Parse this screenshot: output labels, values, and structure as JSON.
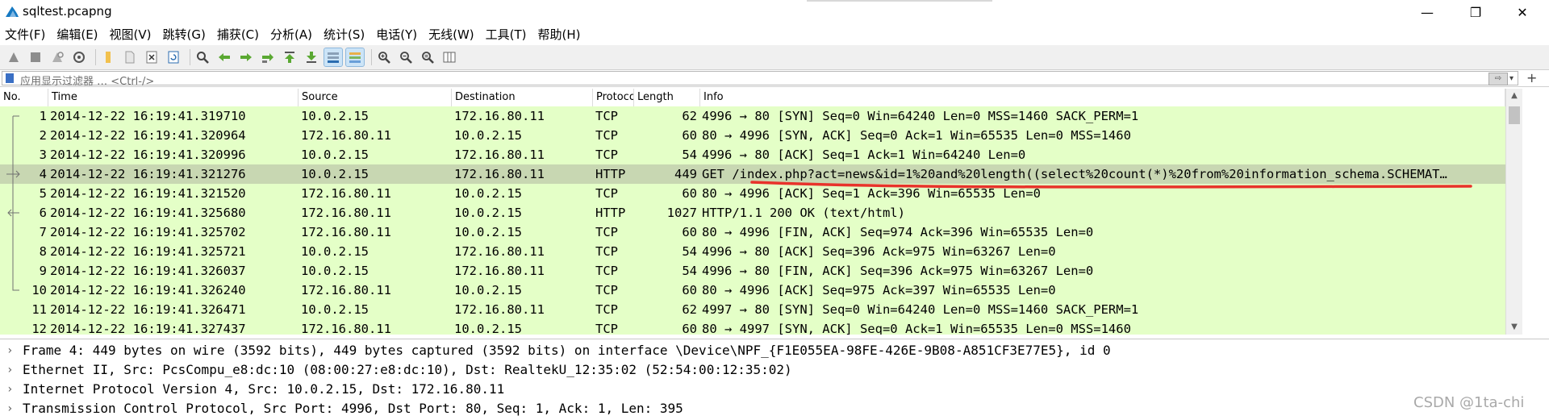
{
  "window": {
    "title": "sqltest.pcapng",
    "minimize": "—",
    "maximize": "❐",
    "close": "✕"
  },
  "menu": [
    "文件(F)",
    "编辑(E)",
    "视图(V)",
    "跳转(G)",
    "捕获(C)",
    "分析(A)",
    "统计(S)",
    "电话(Y)",
    "无线(W)",
    "工具(T)",
    "帮助(H)"
  ],
  "toolbar": {
    "buttons": [
      "start-capture-icon",
      "stop-capture-icon",
      "restart-capture-icon",
      "capture-options-icon",
      "open-file-icon",
      "save-file-icon",
      "close-file-icon",
      "reload-file-icon",
      "find-packet-icon",
      "go-back-icon",
      "go-forward-icon",
      "go-to-packet-icon",
      "go-first-icon",
      "go-last-icon",
      "autoscroll-icon",
      "colorize-icon",
      "zoom-in-icon",
      "zoom-out-icon",
      "zoom-normal-icon",
      "resize-columns-icon"
    ],
    "active": [
      "autoscroll-icon",
      "colorize-icon"
    ]
  },
  "filter": {
    "placeholder": "应用显示过滤器 … <Ctrl-/>",
    "apply": "⇨",
    "dropdown": "▾",
    "add": "+"
  },
  "packet_list": {
    "columns": [
      "No.",
      "Time",
      "Source",
      "Destination",
      "Protocol",
      "Length",
      "Info"
    ],
    "rows": [
      {
        "no": "1",
        "time": "2014-12-22 16:19:41.319710",
        "source": "10.0.2.15",
        "destination": "172.16.80.11",
        "protocol": "TCP",
        "length": "62",
        "info": "4996 → 80 [SYN] Seq=0 Win=64240 Len=0 MSS=1460 SACK_PERM=1"
      },
      {
        "no": "2",
        "time": "2014-12-22 16:19:41.320964",
        "source": "172.16.80.11",
        "destination": "10.0.2.15",
        "protocol": "TCP",
        "length": "60",
        "info": "80 → 4996 [SYN, ACK] Seq=0 Ack=1 Win=65535 Len=0 MSS=1460"
      },
      {
        "no": "3",
        "time": "2014-12-22 16:19:41.320996",
        "source": "10.0.2.15",
        "destination": "172.16.80.11",
        "protocol": "TCP",
        "length": "54",
        "info": "4996 → 80 [ACK] Seq=1 Ack=1 Win=64240 Len=0"
      },
      {
        "no": "4",
        "time": "2014-12-22 16:19:41.321276",
        "source": "10.0.2.15",
        "destination": "172.16.80.11",
        "protocol": "HTTP",
        "length": "449",
        "info": "GET /index.php?act=news&id=1%20and%20length((select%20count(*)%20from%20information_schema.SCHEMAT…"
      },
      {
        "no": "5",
        "time": "2014-12-22 16:19:41.321520",
        "source": "172.16.80.11",
        "destination": "10.0.2.15",
        "protocol": "TCP",
        "length": "60",
        "info": "80 → 4996 [ACK] Seq=1 Ack=396 Win=65535 Len=0"
      },
      {
        "no": "6",
        "time": "2014-12-22 16:19:41.325680",
        "source": "172.16.80.11",
        "destination": "10.0.2.15",
        "protocol": "HTTP",
        "length": "1027",
        "info": "HTTP/1.1 200 OK  (text/html)"
      },
      {
        "no": "7",
        "time": "2014-12-22 16:19:41.325702",
        "source": "172.16.80.11",
        "destination": "10.0.2.15",
        "protocol": "TCP",
        "length": "60",
        "info": "80 → 4996 [FIN, ACK] Seq=974 Ack=396 Win=65535 Len=0"
      },
      {
        "no": "8",
        "time": "2014-12-22 16:19:41.325721",
        "source": "10.0.2.15",
        "destination": "172.16.80.11",
        "protocol": "TCP",
        "length": "54",
        "info": "4996 → 80 [ACK] Seq=396 Ack=975 Win=63267 Len=0"
      },
      {
        "no": "9",
        "time": "2014-12-22 16:19:41.326037",
        "source": "10.0.2.15",
        "destination": "172.16.80.11",
        "protocol": "TCP",
        "length": "54",
        "info": "4996 → 80 [FIN, ACK] Seq=396 Ack=975 Win=63267 Len=0"
      },
      {
        "no": "10",
        "time": "2014-12-22 16:19:41.326240",
        "source": "172.16.80.11",
        "destination": "10.0.2.15",
        "protocol": "TCP",
        "length": "60",
        "info": "80 → 4996 [ACK] Seq=975 Ack=397 Win=65535 Len=0"
      },
      {
        "no": "11",
        "time": "2014-12-22 16:19:41.326471",
        "source": "10.0.2.15",
        "destination": "172.16.80.11",
        "protocol": "TCP",
        "length": "62",
        "info": "4997 → 80 [SYN] Seq=0 Win=64240 Len=0 MSS=1460 SACK_PERM=1"
      },
      {
        "no": "12",
        "time": "2014-12-22 16:19:41.327437",
        "source": "172.16.80.11",
        "destination": "10.0.2.15",
        "protocol": "TCP",
        "length": "60",
        "info": "80 → 4997 [SYN, ACK] Seq=0 Ack=1 Win=65535 Len=0 MSS=1460"
      }
    ],
    "selected_index": 3,
    "colors": {
      "row_bg": "#e4ffc7",
      "selected_bg": "#c8d7b2",
      "annotation": "#e8322b"
    }
  },
  "details": [
    "Frame 4: 449 bytes on wire (3592 bits), 449 bytes captured (3592 bits) on interface \\Device\\NPF_{F1E055EA-98FE-426E-9B08-A851CF3E77E5}, id 0",
    "Ethernet II, Src: PcsCompu_e8:dc:10 (08:00:27:e8:dc:10), Dst: RealtekU_12:35:02 (52:54:00:12:35:02)",
    "Internet Protocol Version 4, Src: 10.0.2.15, Dst: 172.16.80.11",
    "Transmission Control Protocol, Src Port: 4996, Dst Port: 80, Seq: 1, Ack: 1, Len: 395"
  ],
  "watermark": "CSDN @1ta-chi"
}
